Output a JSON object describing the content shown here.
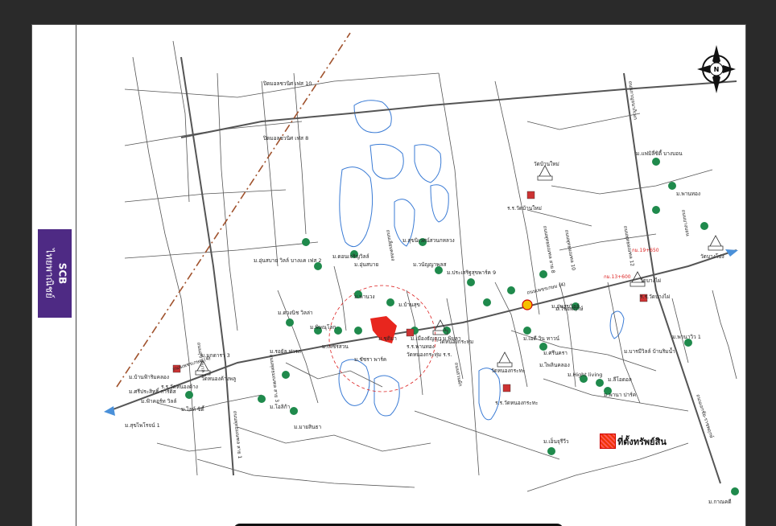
{
  "brand": {
    "line1": "SCB",
    "line2": "ไทยพาณิชย์",
    "color": "#4e2a84"
  },
  "legend": {
    "label": "ที่ตั้งทรัพย์สิน",
    "color": "#e8261e"
  },
  "compass": {
    "letter": "N"
  },
  "roads": {
    "phetkasem": "ถนนเพชรเกษม (4)",
    "mahachai": "ถนนเอกชัย-ราชพฤกษ์",
    "sukhapiban": "ถนนสุขาภิบาล 2",
    "sai1": "ถนนพุทธมณฑล สาย 1",
    "sai8": "ถนนพุทธมณฑล สาย 8",
    "sai10": "ถนนพุทธมณฑล 10",
    "sai12": "ถนนพุทธมณฑล 12",
    "bangbon": "ถนนบางบอน",
    "kanchana": "ถนนกาญจนาภิเษก",
    "soi1": "ถนนเลียบคลอง",
    "soi2": "ถนนสวนผัก",
    "soi3": "ถนนพุทธมณฑล สาย 3"
  },
  "markers": {
    "km1": "กม.13+600",
    "km2": "กม.19+650"
  },
  "places": [
    "ปิดมอลชวนิศ เฟส 10",
    "ปิดมอลชวนิศ เฟส 8",
    "ม.แฟมิลี่ซิตี้ บางบอน",
    "วัดบ้านใหม่",
    "ม.พานทอง",
    "ร.ร.วัดบ้านใหม่",
    "วัดบางโปง",
    "ม.สุขนิเวศน์สวนกหลวง",
    "ม.ดอนเจริญวิลล์",
    "ม.อุ่นสบาย",
    "ม.อุ่นสบาย วิลล์ บางแค เฟส 2",
    "ม.วนัญญาพลส",
    "ม.ประเสริฐสุขพาร์ค 9",
    "วัดบางไผ่",
    "ร.ร.วัดบางไผ่",
    "ม.อุ่นสุขวิลล์",
    "ม.พานวง",
    "ม.บ้านสุข",
    "ม.ดวงนิช วิลล่า",
    "ม.พิษณุโลก",
    "ม.เพชรสวน",
    "ม.ชุติมา",
    "ม.เอดี วิน ทาวน์",
    "ม.รอยัล ท่ารถ",
    "ม.ชัชรา พาร์ค",
    "ม.เมืองธัญญา",
    "ม.พิมลา",
    "ร.ร.พานทอง",
    "วัดหนองกระทุ่ม",
    "วัดหนองกระทุ่ม ร.ร.",
    "ม.ศรีนครา",
    "ม.ไพลินคลอง",
    "ม.มายสินธา",
    "ม.ฟ้าคอร์ท วิลล์",
    "วัดหนองค้างพลู",
    "ร.ร.วัดหนองค้าง",
    "ม.ไลท์ ซิตี้",
    "ม.โอลิก้า",
    "ม.ไชยพฤกษ์",
    "ม.พานาวิว 1",
    "ม.บารมีวิลล์ บ้านริมน้ำ",
    "ม.Hight living",
    "ม.ลีโอดอล",
    "ม.พานา ปาร์ค",
    "ร.ร.วัดหนองกระทะ",
    "วัดหนองกระทะ",
    "ม.สุขไพโรจน์ 1",
    "ม.เอ็นจุรีวีว",
    "ม.กาณคดี",
    "ม.มุกดารา 3",
    "ม.บ้านฟ้าริมคลอง",
    "ม.ศรีประสิทธิ์ การ์ดิส"
  ]
}
